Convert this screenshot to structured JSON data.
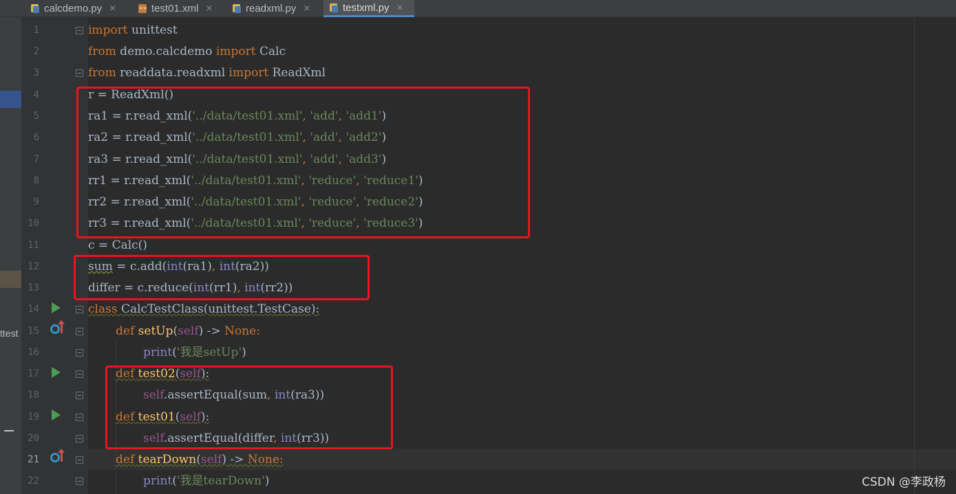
{
  "tabs": [
    {
      "label": "calcdemo.py",
      "icon": "python-file-icon",
      "active": false
    },
    {
      "label": "test01.xml",
      "icon": "xml-file-icon",
      "active": false
    },
    {
      "label": "readxml.py",
      "icon": "python-file-icon",
      "active": false
    },
    {
      "label": "testxml.py",
      "icon": "python-file-icon",
      "active": true
    }
  ],
  "tab_close_glyph": "×",
  "left_panel": {
    "truncated_label": "ttest"
  },
  "gutter": {
    "line_numbers": [
      "1",
      "2",
      "3",
      "4",
      "5",
      "6",
      "7",
      "8",
      "9",
      "10",
      "11",
      "12",
      "13",
      "14",
      "15",
      "16",
      "17",
      "18",
      "19",
      "20",
      "21",
      "22"
    ],
    "current_line": "21",
    "run_icon_lines": [
      "14",
      "17",
      "19"
    ],
    "override_icon_lines": [
      "15",
      "21"
    ]
  },
  "code": {
    "l1": {
      "a": "import",
      "b": " unittest"
    },
    "l2": {
      "a": "from",
      "b": " demo.calcdemo ",
      "c": "import",
      "d": " Calc"
    },
    "l3": {
      "a": "from",
      "b": " readdata.readxml ",
      "c": "import",
      "d": " ReadXml"
    },
    "l4": {
      "a": "r = ReadXml()"
    },
    "l5": {
      "a": "ra1 = r.read_xml(",
      "b": "'../data/test01.xml'",
      "c": ", ",
      "d": "'add'",
      "e": ", ",
      "f": "'add1'",
      "g": ")"
    },
    "l6": {
      "a": "ra2 = r.read_xml(",
      "b": "'../data/test01.xml'",
      "c": ", ",
      "d": "'add'",
      "e": ", ",
      "f": "'add2'",
      "g": ")"
    },
    "l7": {
      "a": "ra3 = r.read_xml(",
      "b": "'../data/test01.xml'",
      "c": ", ",
      "d": "'add'",
      "e": ", ",
      "f": "'add3'",
      "g": ")"
    },
    "l8": {
      "a": "rr1 = r.read_xml(",
      "b": "'../data/test01.xml'",
      "c": ", ",
      "d": "'reduce'",
      "e": ", ",
      "f": "'reduce1'",
      "g": ")"
    },
    "l9": {
      "a": "rr2 = r.read_xml(",
      "b": "'../data/test01.xml'",
      "c": ", ",
      "d": "'reduce'",
      "e": ", ",
      "f": "'reduce2'",
      "g": ")"
    },
    "l10": {
      "a": "rr3 = r.read_xml(",
      "b": "'../data/test01.xml'",
      "c": ", ",
      "d": "'reduce'",
      "e": ", ",
      "f": "'reduce3'",
      "g": ")"
    },
    "l11": {
      "a": "c = Calc()"
    },
    "l12": {
      "a": "sum",
      "b": " = c.add(",
      "c": "int",
      "d": "(ra1)",
      "e": ", ",
      "f": "int",
      "g": "(ra2))"
    },
    "l13": {
      "a": "differ = c.reduce(",
      "b": "int",
      "c": "(rr1)",
      "d": ", ",
      "e": "int",
      "f": "(rr2))"
    },
    "l14": {
      "a": "class",
      "b": " CalcTestClass(unittest.TestCase):"
    },
    "l15": {
      "a": "def",
      "b": " ",
      "c": "setUp",
      "d": "(",
      "e": "self",
      "f": ") -> ",
      "g": "None",
      "h": ":"
    },
    "l16": {
      "a": "print",
      "b": "(",
      "c": "'我是setUp'",
      "d": ")"
    },
    "l17": {
      "a": "def",
      "b": " ",
      "c": "test02",
      "d": "(",
      "e": "self",
      "f": "):"
    },
    "l18": {
      "a": "self",
      "b": ".assertEqual(sum",
      "c": ", ",
      "d": "int",
      "e": "(ra3))"
    },
    "l19": {
      "a": "def",
      "b": " ",
      "c": "test01",
      "d": "(",
      "e": "self",
      "f": "):"
    },
    "l20": {
      "a": "self",
      "b": ".assertEqual(differ",
      "c": ", ",
      "d": "int",
      "e": "(rr3))"
    },
    "l21": {
      "a": "def",
      "b": " ",
      "c": "tearDown",
      "d": "(",
      "e": "self",
      "f": ") -> ",
      "g": "None",
      "h": ":"
    },
    "l22": {
      "a": "print",
      "b": "(",
      "c": "'我是tearDown'",
      "d": ")"
    }
  },
  "watermark": "CSDN @李政杨",
  "colors": {
    "background": "#2b2b2b",
    "gutter": "#313335",
    "keyword": "#cc7832",
    "string": "#6a8759",
    "builtin": "#8888c6",
    "self": "#94558d",
    "function": "#ffc66d",
    "highlight_box": "#e8141f"
  }
}
